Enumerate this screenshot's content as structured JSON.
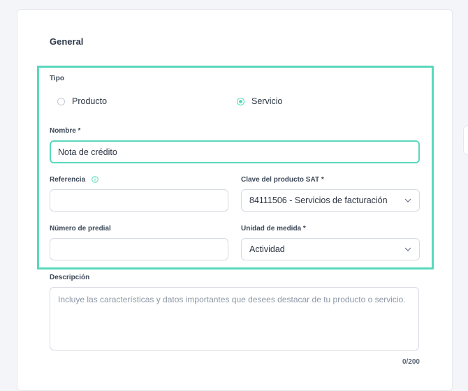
{
  "section": {
    "title": "General"
  },
  "tipo": {
    "label": "Tipo",
    "options": [
      {
        "label": "Producto",
        "checked": false
      },
      {
        "label": "Servicio",
        "checked": true
      }
    ]
  },
  "nombre": {
    "label": "Nombre *",
    "value": "Nota de crédito"
  },
  "referencia": {
    "label": "Referencia",
    "value": "",
    "icon": "info-icon"
  },
  "clave_sat": {
    "label": "Clave del producto SAT *",
    "value": "84111506 - Servicios de facturación"
  },
  "predial": {
    "label": "Número de predial",
    "value": ""
  },
  "unidad": {
    "label": "Unidad de medida *",
    "value": "Actividad"
  },
  "descripcion": {
    "label": "Descripción",
    "placeholder": "Incluye las características y datos importantes que desees destacar de tu producto o servicio.",
    "counter": "0/200"
  },
  "colors": {
    "accent": "#5ad8bd",
    "border": "#d6dae2"
  }
}
